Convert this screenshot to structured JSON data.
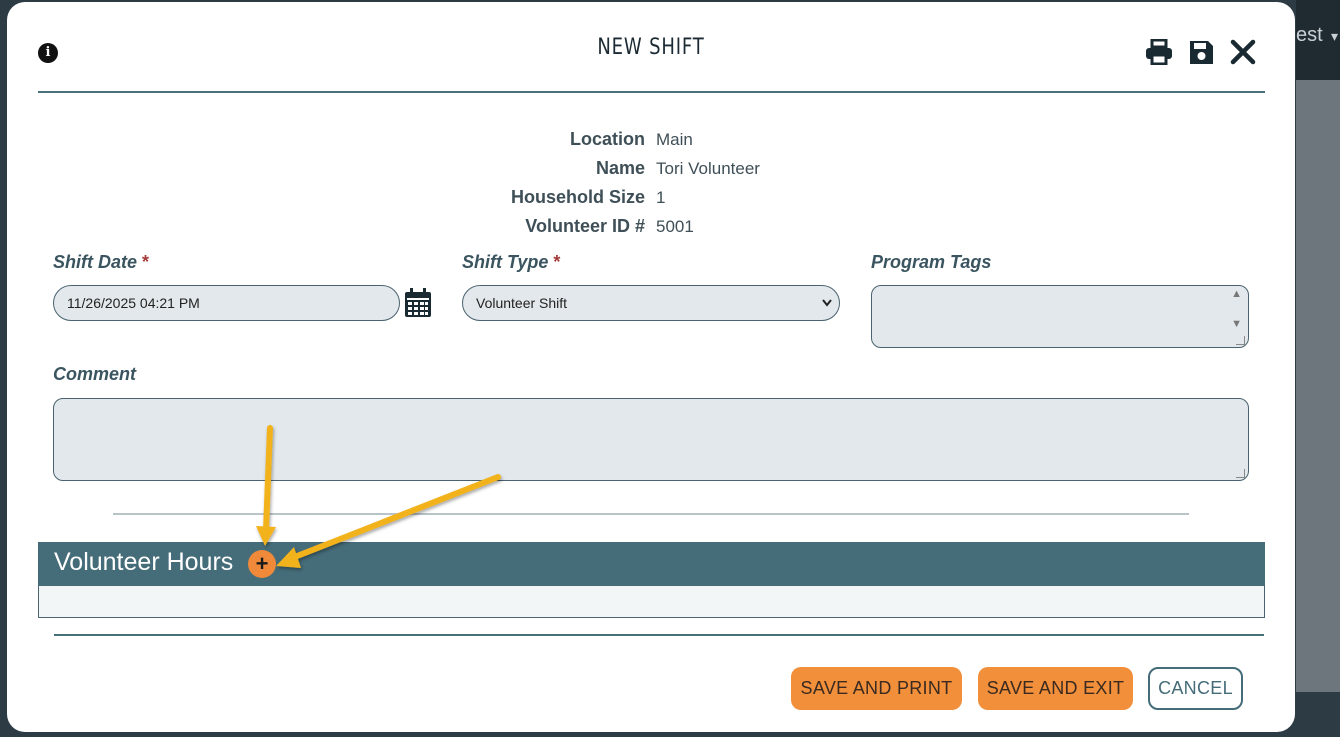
{
  "background": {
    "partial_text": "est"
  },
  "dialog": {
    "title": "NEW SHIFT",
    "icons": {
      "info": "info-icon",
      "print": "print-icon",
      "save": "save-icon",
      "close": "close-icon"
    }
  },
  "details": [
    {
      "label": "Location",
      "value": "Main"
    },
    {
      "label": "Name",
      "value": "Tori Volunteer"
    },
    {
      "label": "Household Size",
      "value": "1"
    },
    {
      "label": "Volunteer ID #",
      "value": "5001"
    }
  ],
  "form": {
    "shift_date": {
      "label": "Shift Date",
      "required_mark": "*",
      "value": "11/26/2025 04:21 PM"
    },
    "shift_type": {
      "label": "Shift Type",
      "required_mark": "*",
      "value": "Volunteer Shift"
    },
    "program_tags": {
      "label": "Program Tags",
      "value": ""
    },
    "comment": {
      "label": "Comment",
      "value": ""
    }
  },
  "section": {
    "title": "Volunteer Hours",
    "add_symbol": "+"
  },
  "buttons": {
    "save_print": "SAVE AND PRINT",
    "save_exit": "SAVE AND EXIT",
    "cancel": "CANCEL"
  },
  "colors": {
    "accent_orange": "#f28f3b",
    "header_teal": "#456c79",
    "annotation_arrow": "#f2b21b"
  }
}
